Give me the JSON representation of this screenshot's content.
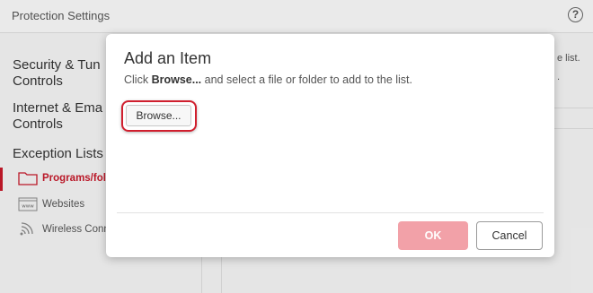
{
  "app": {
    "title": "Protection Settings",
    "help_icon": "?"
  },
  "sidebar": {
    "sections": [
      {
        "label_line1": "Security & Tun",
        "label_line2": "Controls"
      },
      {
        "label_line1": "Internet & Ema",
        "label_line2": "Controls"
      },
      {
        "label_line1": "Exception Lists"
      }
    ],
    "items": [
      {
        "label": "Programs/fol",
        "icon": "folder-icon",
        "active": true
      },
      {
        "label": "Websites",
        "icon": "www-icon",
        "active": false
      },
      {
        "label": "Wireless Conn",
        "icon": "wireless-icon",
        "active": false
      }
    ]
  },
  "content": {
    "partial_text_1": "e list.",
    "partial_text_2": "."
  },
  "dialog": {
    "title": "Add an Item",
    "instruction_prefix": "Click ",
    "instruction_bold": "Browse...",
    "instruction_suffix": " and select a file or folder to add to the list.",
    "browse_label": "Browse...",
    "ok_label": "OK",
    "cancel_label": "Cancel"
  },
  "colors": {
    "accent": "#c41a2b",
    "ok_disabled": "#f2a1a8",
    "highlight_ring": "#d01f2e"
  }
}
